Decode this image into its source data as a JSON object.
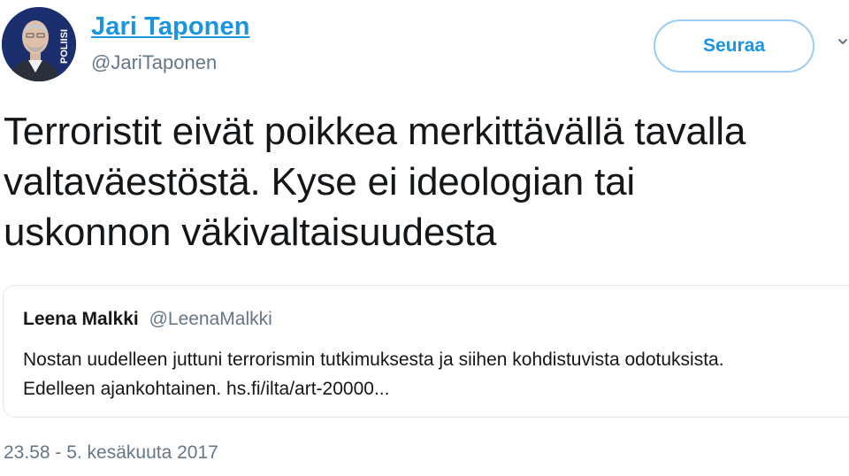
{
  "author": {
    "name": "Jari Taponen",
    "handle": "@JariTaponen",
    "avatar_badge_text": "POLIISI"
  },
  "follow_button": {
    "label": "Seuraa"
  },
  "tweet": {
    "text_lines": [
      "Terroristit eivät poikkea merkittävällä tavalla",
      "valtaväestöstä. Kyse ei ideologian tai",
      "uskonnon väkivaltaisuudesta"
    ],
    "timestamp": "23.58 - 5. kesäkuuta 2017"
  },
  "quoted_tweet": {
    "name": "Leena Malkki",
    "handle": "@LeenaMalkki",
    "text_lines": [
      "Nostan uudelleen juttuni terrorismin tutkimuksesta ja siihen kohdistuvista odotuksista.",
      "Edelleen ajankohtainen. hs.fi/ilta/art-20000..."
    ]
  },
  "colors": {
    "link_blue": "#1b95e0",
    "muted_gray": "#657786",
    "text_dark": "#14171a",
    "card_border": "#e1e8ed",
    "avatar_bg": "#1b2f6e"
  },
  "icons": {
    "menu_caret": "chevron-down-icon"
  }
}
